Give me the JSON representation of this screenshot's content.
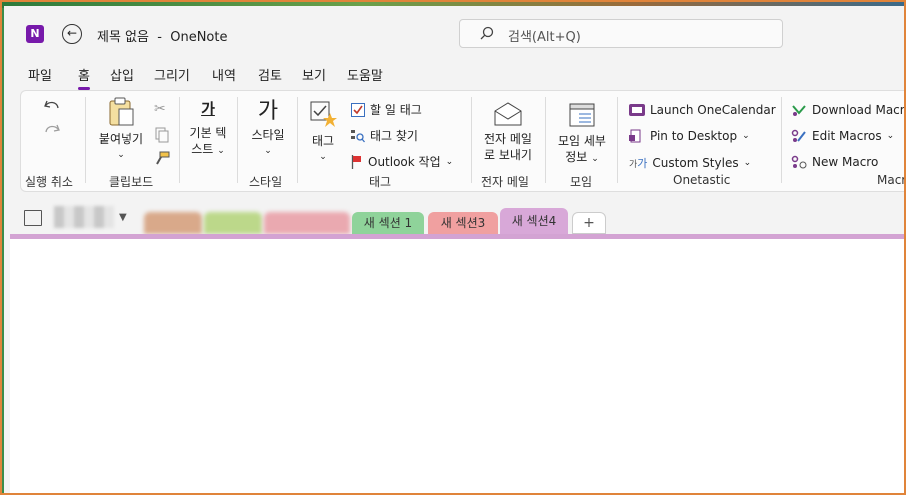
{
  "title": {
    "app_initial": "N",
    "document": "제목 없음",
    "separator": "-",
    "app_name": "OneNote"
  },
  "search": {
    "placeholder": "검색(Alt+Q)"
  },
  "menu": [
    "파일",
    "홈",
    "삽입",
    "그리기",
    "내역",
    "검토",
    "보기",
    "도움말"
  ],
  "menu_active": "홈",
  "ribbon": {
    "undo": {
      "group": "실행 취소"
    },
    "clipboard": {
      "paste_label": "붙여넣기",
      "group": "클립보드"
    },
    "basic_text": {
      "label1": "기본 텍",
      "label2": "스트",
      "glyph": "가",
      "group": ""
    },
    "styles": {
      "label": "스타일",
      "glyph": "가",
      "group": "스타일"
    },
    "tags": {
      "tag_label": "태그",
      "todo": "할 일 태그",
      "find": "태그 찾기",
      "outlook": "Outlook 작업",
      "group": "태그"
    },
    "email": {
      "label1": "전자 메일",
      "label2": "로 보내기",
      "group": "전자 메일"
    },
    "meeting": {
      "label1": "모임 세부",
      "label2": "정보",
      "group": "모임"
    },
    "onetastic": {
      "cal": "Launch OneCalendar",
      "pin": "Pin to Desktop",
      "styles": "Custom Styles",
      "group": "Onetastic"
    },
    "macros": {
      "download": "Download Macros",
      "edit": "Edit Macros",
      "new": "New Macro",
      "group": "Macro"
    }
  },
  "sections": {
    "tab1": "새 섹션 1",
    "tab3": "새 섹션3",
    "tab4": "새 섹션4",
    "add": "+"
  },
  "colors": {
    "accent": "#7719aa",
    "tab1": "#8fd39a",
    "tab3": "#f0a0a0",
    "tab4": "#d8a8d8"
  }
}
